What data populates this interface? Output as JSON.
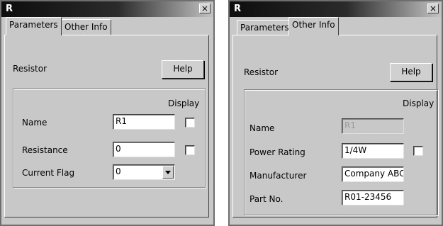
{
  "left_dialog": {
    "title": "R",
    "close_glyph": "×",
    "tabs": [
      {
        "label": "Parameters",
        "active": true
      },
      {
        "label": "Other Info",
        "active": false
      }
    ],
    "section_label": "Resistor",
    "help_label": "Help",
    "display_header": "Display",
    "fields": [
      {
        "label": "Name",
        "value": "R1",
        "has_checkbox": true
      },
      {
        "label": "Resistance",
        "value": "0",
        "has_checkbox": true
      },
      {
        "label": "Current Flag",
        "value": "0",
        "type": "dropdown"
      }
    ]
  },
  "right_dialog": {
    "title": "R",
    "close_glyph": "×",
    "tabs": [
      {
        "label": "Parameters",
        "active": false
      },
      {
        "label": "Other Info",
        "active": true
      }
    ],
    "section_label": "Resistor",
    "help_label": "Help",
    "display_header": "Display",
    "fields": [
      {
        "label": "Name",
        "value": "R1",
        "disabled": true
      },
      {
        "label": "Power Rating",
        "value": "1/4W",
        "has_checkbox": true
      },
      {
        "label": "Manufacturer",
        "value": "Company ABC"
      },
      {
        "label": "Part No.",
        "value": "R01-23456"
      }
    ]
  }
}
